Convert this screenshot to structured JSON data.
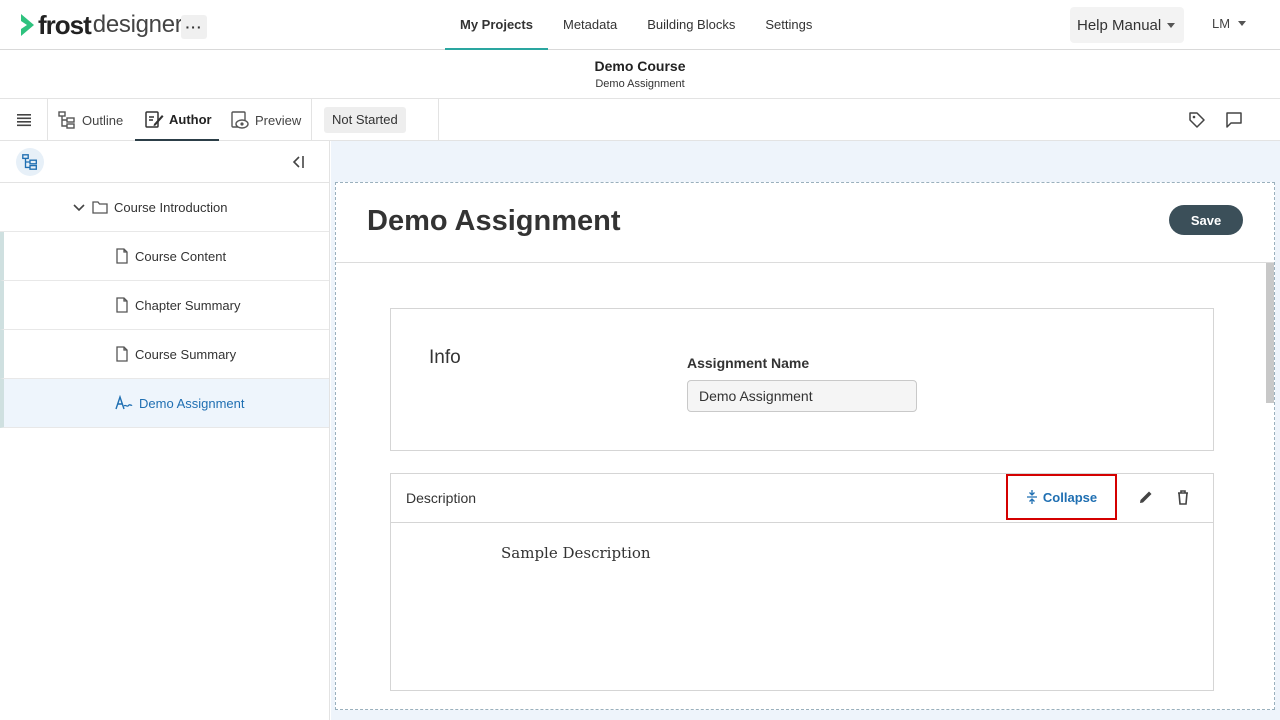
{
  "app": {
    "logo_bold": "frost",
    "logo_light": "designer",
    "more_label": "···",
    "accent_color": "#2aa6a0"
  },
  "nav": {
    "tabs": [
      {
        "label": "My Projects",
        "active": true
      },
      {
        "label": "Metadata",
        "active": false
      },
      {
        "label": "Building Blocks",
        "active": false
      },
      {
        "label": "Settings",
        "active": false
      }
    ],
    "help_label": "Help Manual",
    "user_initials": "LM"
  },
  "title_bar": {
    "title": "Demo Course",
    "subtitle": "Demo Assignment"
  },
  "toolbar": {
    "outline_label": "Outline",
    "author_label": "Author",
    "preview_label": "Preview",
    "status_label": "Not Started",
    "icons": [
      "menu-icon",
      "outline-icon",
      "author-icon",
      "preview-icon",
      "tag-icon",
      "comment-icon"
    ]
  },
  "sidebar": {
    "folder": "Course Introduction",
    "items": [
      {
        "label": "Course Content",
        "icon": "page-icon"
      },
      {
        "label": "Chapter Summary",
        "icon": "page-icon"
      },
      {
        "label": "Course Summary",
        "icon": "page-icon"
      },
      {
        "label": "Demo Assignment",
        "icon": "assignment-icon",
        "selected": true
      }
    ]
  },
  "main": {
    "title": "Demo Assignment",
    "save_label": "Save",
    "info": {
      "label": "Info",
      "field_label": "Assignment Name",
      "field_value": "Demo Assignment"
    },
    "description": {
      "label": "Description",
      "collapse_label": "Collapse",
      "body": "Sample Description"
    }
  }
}
